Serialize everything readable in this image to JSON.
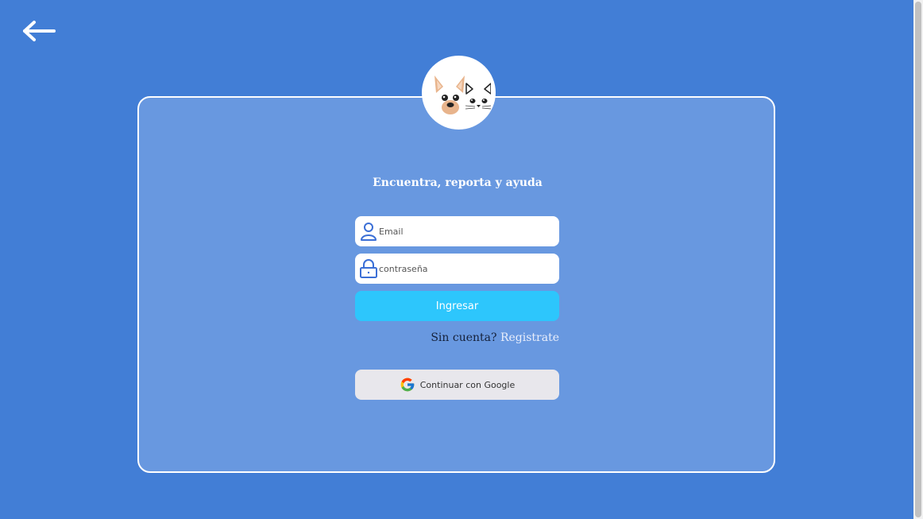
{
  "header": {
    "back_icon": "arrow-left-icon"
  },
  "logo": {
    "icon": "dog-and-cat-logo"
  },
  "tagline": "Encuentra, reporta y ayuda",
  "form": {
    "email": {
      "placeholder": "Email",
      "value": "",
      "icon": "user-icon"
    },
    "password": {
      "placeholder": "contraseña",
      "value": "",
      "icon": "lock-icon"
    },
    "submit_label": "Ingresar"
  },
  "signup": {
    "question": "Sin cuenta?",
    "link_label": "Registrate"
  },
  "google": {
    "label": "Continuar con Google",
    "icon": "google-icon"
  },
  "colors": {
    "background": "#427ed6",
    "card": "#6898e0",
    "primary_button": "#2dc6fc",
    "google_button": "#e8e7ec",
    "icon_blue": "#3b6fd6"
  }
}
